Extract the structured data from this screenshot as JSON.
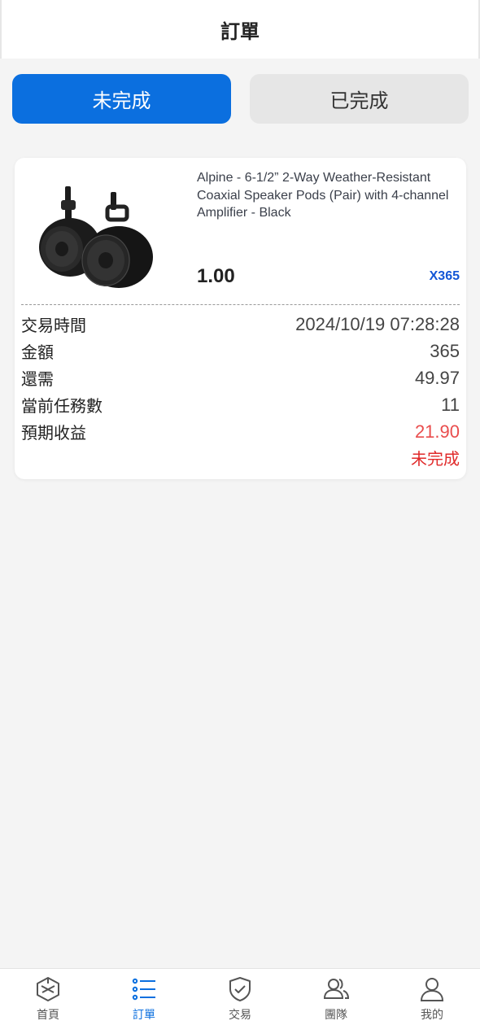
{
  "header": {
    "title": "訂單"
  },
  "tabs": [
    {
      "label": "未完成",
      "active": true
    },
    {
      "label": "已完成",
      "active": false
    }
  ],
  "order": {
    "image_icon": "speaker-pods-image",
    "title": "Alpine - 6-1/2” 2-Way Weather-Resistant Coaxial Speaker Pods (Pair) with 4-channel Amplifier - Black",
    "price": "1.00",
    "quantity": "X365",
    "rows": [
      {
        "label": "交易時間",
        "value": "2024/10/19 07:28:28"
      },
      {
        "label": "金額",
        "value": "365"
      },
      {
        "label": "還需",
        "value": "49.97"
      },
      {
        "label": "當前任務數",
        "value": "11"
      },
      {
        "label": "預期收益",
        "value": "21.90"
      }
    ],
    "status": "未完成"
  },
  "nav": [
    {
      "label": "首頁",
      "icon": "home-cube-icon"
    },
    {
      "label": "訂單",
      "icon": "list-icon",
      "active": true
    },
    {
      "label": "交易",
      "icon": "shield-check-icon"
    },
    {
      "label": "團隊",
      "icon": "team-icon"
    },
    {
      "label": "我的",
      "icon": "user-icon"
    }
  ],
  "colors": {
    "accent": "#0b6fdf",
    "quantity": "#1356d6",
    "profit": "#e94d4d",
    "status": "#e02a2a"
  }
}
